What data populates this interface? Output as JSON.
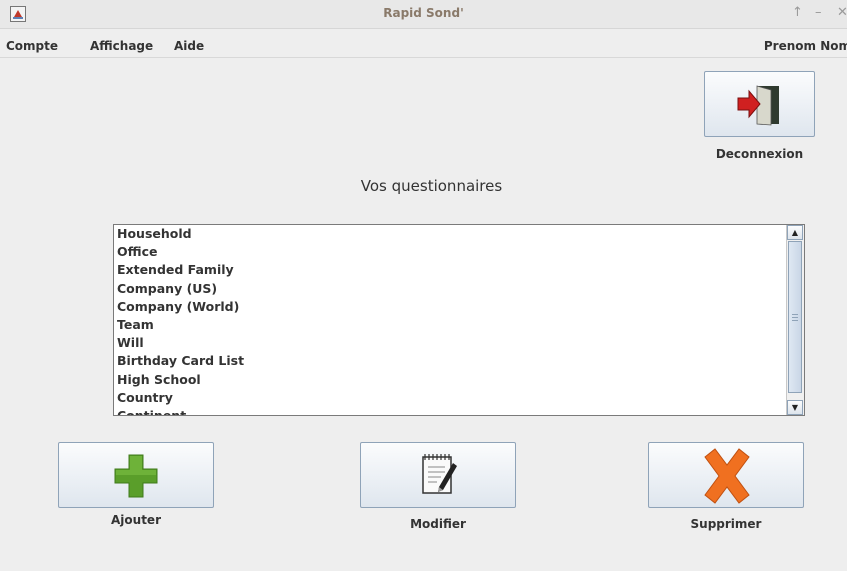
{
  "window": {
    "title": "Rapid Sond'"
  },
  "menubar": {
    "items": [
      "Compte",
      "Affichage",
      "Aide"
    ],
    "user": "Prenom Nom"
  },
  "logout": {
    "label": "Deconnexion",
    "icon": "door-exit-icon"
  },
  "heading": "Vos questionnaires",
  "questionnaires": [
    "Household",
    "Office",
    "Extended Family",
    "Company (US)",
    "Company (World)",
    "Team",
    "Will",
    "Birthday Card List",
    "High School",
    "Country",
    "Continent"
  ],
  "actions": {
    "add": {
      "label": "Ajouter",
      "icon": "plus-icon"
    },
    "edit": {
      "label": "Modifier",
      "icon": "edit-document-icon"
    },
    "delete": {
      "label": "Supprimer",
      "icon": "cross-icon"
    }
  },
  "colors": {
    "add_green": "#5a9e2a",
    "delete_orange": "#f07020",
    "exit_red": "#d02020"
  }
}
